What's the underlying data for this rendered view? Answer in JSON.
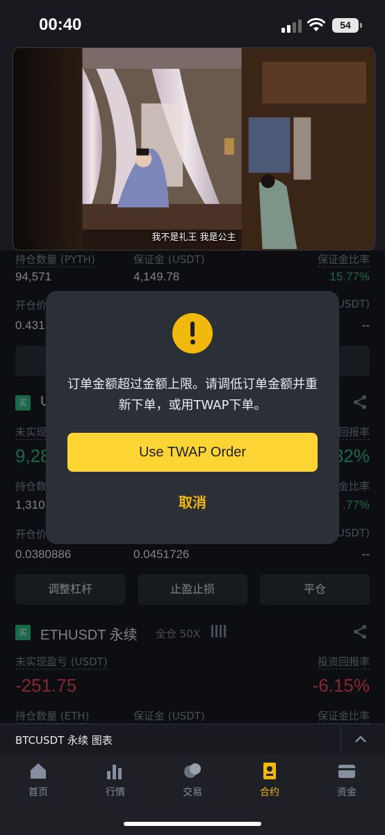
{
  "status_bar": {
    "time": "00:40",
    "battery": "54"
  },
  "video": {
    "subtitle": "我不是礼王  我是公主"
  },
  "position1": {
    "labels": [
      "持仓数量 (PYTH)",
      "保证金 (USDT)",
      "保证金比率"
    ],
    "values": [
      "94,571",
      "4,149.78",
      "15.77%"
    ],
    "entry_label": "开仓价",
    "liq_label": "USDT)",
    "entry_value": "0.431",
    "liq_value": "--"
  },
  "position2": {
    "tag": "买",
    "symbol_partial": "U",
    "pnl_label": "未实现",
    "roe_label": "回报率",
    "pnl_value": "9,28",
    "roe_value": "32%",
    "qty_label": "持仓数",
    "margin_ratio_label": "金比率",
    "qty_value": "1,310",
    "margin_ratio_value": ".77%",
    "entry_label": "开仓价",
    "liq_label": "USDT)",
    "entry_value": "0.0380886",
    "mark_value": "0.0451726",
    "liq_value": "--",
    "buttons": [
      "调整杠杆",
      "止盈止损",
      "平仓"
    ]
  },
  "position3": {
    "tag": "买",
    "symbol": "ETHUSDT 永续",
    "mode": "全仓 50X",
    "pnl_label": "未实现盈亏 (USDT)",
    "roe_label": "投资回报率",
    "pnl_value": "-251.75",
    "roe_value": "-6.15%",
    "qty_label": "持仓数量 (ETH)",
    "margin_label": "保证金 (USDT)",
    "margin_ratio_label": "保证金比率"
  },
  "dialog": {
    "message": "订单金额超过金额上限。请调低订单金额并重新下单，或用TWAP下单。",
    "primary_button": "Use TWAP Order",
    "cancel_button": "取消"
  },
  "bottom_strip": {
    "title": "BTCUSDT 永续  图表"
  },
  "tabs": [
    {
      "label": "首页",
      "icon": "home-icon"
    },
    {
      "label": "行情",
      "icon": "markets-icon"
    },
    {
      "label": "交易",
      "icon": "trade-icon"
    },
    {
      "label": "合约",
      "icon": "futures-icon",
      "active": true
    },
    {
      "label": "资金",
      "icon": "wallet-icon"
    }
  ],
  "colors": {
    "accent": "#f0b90b",
    "green": "#2ebd85",
    "red": "#f6465d",
    "bg": "#181a20"
  }
}
